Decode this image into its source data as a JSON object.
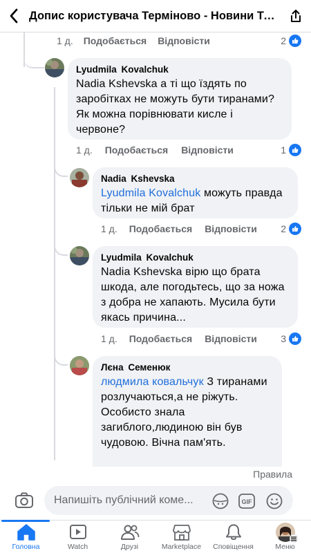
{
  "header": {
    "title": "Допис користувача Терміново - Новини Тер..."
  },
  "top_meta": {
    "time": "1 д.",
    "like": "Подобається",
    "reply": "Відповісти",
    "reaction_count": "2"
  },
  "comments": [
    {
      "author": "Lyudmila  Kovalchuk",
      "text": "Nadia Kshevska а ті що їздять по заробітках не можуть бути тиранами? Як можна порівнювати кисле і червоне?",
      "mention": "",
      "time": "1 д.",
      "like": "Подобається",
      "reply": "Відповісти",
      "reaction_count": "1"
    },
    {
      "author": "Nadia  Kshevska",
      "mention": "Lyudmila  Kovalchuk",
      "text": " можуть правда тільки не мій брат",
      "time": "1 д.",
      "like": "Подобається",
      "reply": "Відповісти",
      "reaction_count": "2"
    },
    {
      "author": "Lyudmila  Kovalchuk",
      "mention": "",
      "text": "Nadia Kshevska вірю що брата шкода, але погодьтесь, що за ножа з добра не хапають. Мусила бути якась причина...",
      "time": "1 д.",
      "like": "Подобається",
      "reply": "Відповісти",
      "reaction_count": "3"
    },
    {
      "author": "Лєна Семенюк",
      "mention": "людмила ковальчук",
      "text": " З тиранами розлучаються,а не ріжуть. Особисто знала загиблого,людиною він був чудовою. Вічна пам'ять."
    }
  ],
  "rules_link": "Правила",
  "composer": {
    "placeholder": "Напишіть публічний комe..."
  },
  "tabs": [
    {
      "label": "Головна",
      "icon": "home-icon",
      "active": true
    },
    {
      "label": "Watch",
      "icon": "watch-icon"
    },
    {
      "label": "Друзі",
      "icon": "friends-icon"
    },
    {
      "label": "Marketplace",
      "icon": "marketplace-icon"
    },
    {
      "label": "Сповіщення",
      "icon": "bell-icon"
    },
    {
      "label": "Меню",
      "icon": "menu-avatar"
    }
  ],
  "colors": {
    "accent": "#1877f2",
    "mention": "#216fdb",
    "bubble": "#f0f2f5",
    "meta": "#65676b"
  }
}
